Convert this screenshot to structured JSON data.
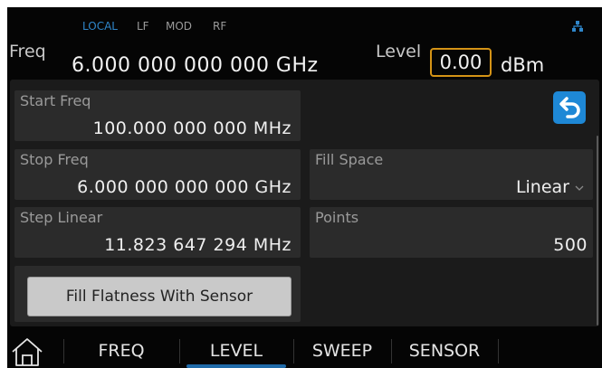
{
  "status": {
    "local": "LOCAL",
    "lf": "LF",
    "mod": "MOD",
    "rf": "RF"
  },
  "header": {
    "freq_label": "Freq",
    "freq_value": "6.000 000 000 000  GHz",
    "level_label": "Level",
    "level_value": "0.00",
    "level_unit": "dBm"
  },
  "fields": {
    "start_freq": {
      "label": "Start Freq",
      "value": "100.000 000 000 MHz"
    },
    "stop_freq": {
      "label": "Stop Freq",
      "value": "6.000 000 000 000 GHz"
    },
    "step_linear": {
      "label": "Step Linear",
      "value": "11.823 647 294 MHz"
    },
    "fill_space": {
      "label": "Fill Space",
      "value": "Linear"
    },
    "points": {
      "label": "Points",
      "value": "500"
    }
  },
  "buttons": {
    "fill_flatness": "Fill Flatness With Sensor"
  },
  "tabs": [
    {
      "label": "FREQ"
    },
    {
      "label": "LEVEL"
    },
    {
      "label": "SWEEP"
    },
    {
      "label": "SENSOR"
    }
  ],
  "colors": {
    "accent": "#1e88d6",
    "level_highlight": "#d49316",
    "local_status": "#2f86c9"
  },
  "icons": {
    "network": "network-icon",
    "back": "back-arrow-icon",
    "home": "home-icon",
    "dropdown": "chevron-down-icon"
  }
}
